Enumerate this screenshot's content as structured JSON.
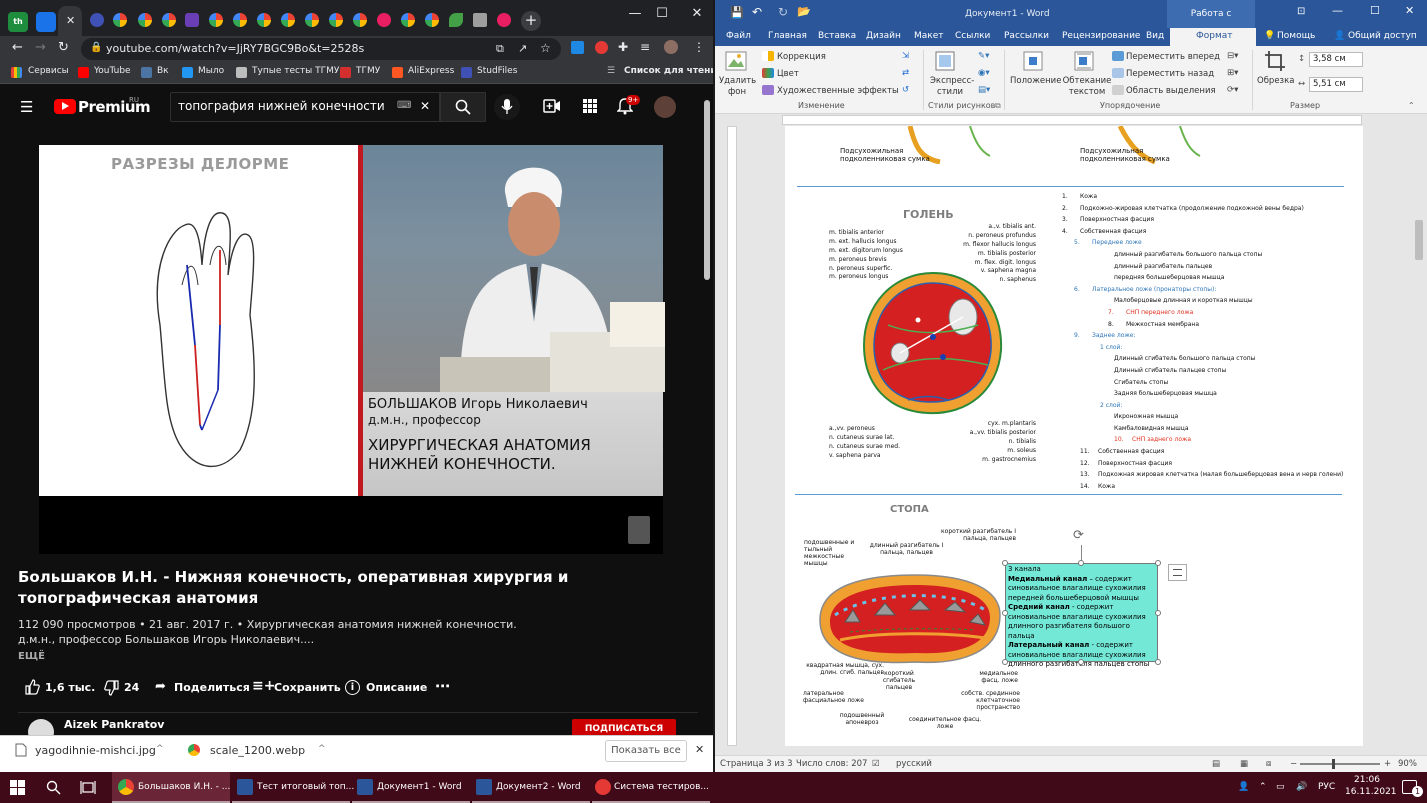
{
  "browser": {
    "tab_favicon_text": "th",
    "active_tab_close": "✕",
    "new_tab": "+",
    "url": "youtube.com/watch?v=JjRY7BGC9Bo&t=2528s",
    "window_controls": {
      "minimize": "—",
      "maximize": "☐",
      "close": "✕"
    },
    "bookmarks": [
      "Сервисы",
      "YouTube",
      "Вк",
      "Мыло",
      "Тупые тесты ТГМУ",
      "ТГМУ",
      "AliExpress",
      "StudFiles"
    ],
    "reading_list": "Список для чтения"
  },
  "youtube": {
    "brand": "Premium",
    "brand_region": "RU",
    "search_value": "топография нижней конечности",
    "search_clear": "✕",
    "notifications_badge": "9+",
    "video_title_slide": "РАЗРЕЗЫ ДЕЛОРМЕ",
    "caption_name": "БОЛЬШАКОВ Игорь Николаевич",
    "caption_degree": "д.м.н., профессор",
    "caption_course": "ХИРУРГИЧЕСКАЯ АНАТОМИЯ НИЖНЕЙ КОНЕЧНОСТИ.",
    "title": "Большаков И.Н. - Нижняя конечность, оперативная хирургия и топографическая анатомия",
    "meta_line1": "112 090 просмотров • 21 авг. 2017 г. • Хирургическая анатомия нижней конечности.",
    "meta_line2": "д.м.н., профессор Большаков Игорь Николаевич....",
    "more": "ЕЩЁ",
    "likes": "1,6 тыс.",
    "dislikes": "24",
    "share": "Поделиться",
    "save": "Сохранить",
    "description": "Описание",
    "more_actions": "⋯",
    "commenter": "Aizek Pankratov",
    "subscribe": "ПОДПИСАТЬСЯ"
  },
  "downloads": {
    "items": [
      "yagodihnie-mishci.jpg",
      "scale_1200.webp"
    ],
    "show_all": "Показать все",
    "close": "✕"
  },
  "word": {
    "doc_title": "Документ1 - Word",
    "context_tab": "Работа с рисунками",
    "tabs": [
      "Файл",
      "Главная",
      "Вставка",
      "Дизайн",
      "Макет",
      "Ссылки",
      "Рассылки",
      "Рецензирование",
      "Вид"
    ],
    "active_tab": "Формат",
    "help": "Помощь",
    "share": "Общий доступ",
    "ribbon": {
      "remove_bg": "Удалить фон",
      "correction": "Коррекция",
      "color": "Цвет",
      "artistic": "Художественные эффекты",
      "group_change": "Изменение",
      "express_styles": "Экспресс-стили",
      "group_styles": "Стили рисунков",
      "position": "Положение",
      "wrap_text": "Обтекание текстом",
      "bring_forward": "Переместить вперед",
      "send_backward": "Переместить назад",
      "selection_pane": "Область выделения",
      "group_arrange": "Упорядочение",
      "crop": "Обрезка",
      "height": "3,58 см",
      "width": "5,51 см",
      "group_size": "Размер"
    },
    "page": {
      "top_label_left": "Подсухожильная подколенниковая сумка",
      "top_label_right": "Подсухожильная подколенниковая сумка",
      "shin_title": "ГОЛЕНЬ",
      "foot_title": "СТОПА",
      "list": [
        {
          "n": "1.",
          "t": "Кожа",
          "c": ""
        },
        {
          "n": "2.",
          "t": "Подкожно-жировая клетчатка (продолжение подкожной вены бедра)",
          "c": ""
        },
        {
          "n": "3.",
          "t": "Поверхностная фасция",
          "c": ""
        },
        {
          "n": "4.",
          "t": "Собственная фасция",
          "c": ""
        },
        {
          "n": "5.",
          "t": "Переднее ложе",
          "c": "blue"
        },
        {
          "n": "",
          "t": "длинный разгибатель большого пальца стопы",
          "c": ""
        },
        {
          "n": "",
          "t": "длинный разгибатель пальцев",
          "c": ""
        },
        {
          "n": "",
          "t": "передняя большеберцовая мышца",
          "c": ""
        },
        {
          "n": "6.",
          "t": "Латеральное ложе (пронаторы стопы):",
          "c": "blue"
        },
        {
          "n": "",
          "t": "Малоберцовые длинная и короткая мышцы",
          "c": ""
        },
        {
          "n": "7.",
          "t": "СНП переднего ложа",
          "c": "red"
        },
        {
          "n": "8.",
          "t": "Межкостная мембрана",
          "c": ""
        },
        {
          "n": "9.",
          "t": "Заднее ложе:",
          "c": "blue"
        },
        {
          "n": "",
          "t": "1 слой:",
          "c": "blue"
        },
        {
          "n": "",
          "t": "Длинный сгибатель большого пальца стопы",
          "c": ""
        },
        {
          "n": "",
          "t": "Длинный сгибатель пальцев стопы",
          "c": ""
        },
        {
          "n": "",
          "t": "Сгибатель стопы",
          "c": ""
        },
        {
          "n": "",
          "t": "Задняя большеберцовая мышца",
          "c": ""
        },
        {
          "n": "",
          "t": "2 слой:",
          "c": "blue"
        },
        {
          "n": "",
          "t": "Икроножная мышца",
          "c": ""
        },
        {
          "n": "",
          "t": "Камбаловидная мышца",
          "c": ""
        },
        {
          "n": "10.",
          "t": "СНП заднего ложа",
          "c": "red"
        },
        {
          "n": "11.",
          "t": "Собственная фасция",
          "c": ""
        },
        {
          "n": "12.",
          "t": "Поверхностная фасция",
          "c": ""
        },
        {
          "n": "13.",
          "t": "Подкожная жировая клетчатка (малая большеберцовая вена и нерв голени)",
          "c": ""
        },
        {
          "n": "14.",
          "t": "Кожа",
          "c": ""
        }
      ],
      "shin_labels_left": [
        "m. tibialis anterior",
        "m. ext. hallucis longus",
        "m. ext. digitorum longus",
        "m. peroneus brevis",
        "n. peroneus superfic.",
        "m. peroneus longus"
      ],
      "shin_labels_right": [
        "a.,v. tibialis ant.",
        "n. peroneus profundus",
        "m. flexor hallucis longus",
        "m. tibialis posterior",
        "m. flex. digit. longus",
        "v. saphena magna",
        "n. saphenus"
      ],
      "shin_labels_bottom_left": [
        "a.,vv. peroneus",
        "n. cutaneus surae lat.",
        "n. cutaneus surae med.",
        "v. saphena parva"
      ],
      "shin_labels_bottom_right": [
        "сух. m.plantaris",
        "a.,vv. tibialis posterior",
        "n. tibialis",
        "m. soleus",
        "m. gastrocnemius"
      ],
      "foot_labels": {
        "a": "подошвенные и тыльный межкостные мышцы",
        "b": "длинный разгибатель I пальца, пальцев",
        "c": "короткий разгибатель I пальца, пальцев",
        "d": "квадратная мышца, сух. длин. сгиб. пальцев",
        "e": "короткий сгибатель пальцев",
        "f": "латеральное фасциальное ложе",
        "g": "подошвенный апоневроз",
        "h": "соединительное фасц. ложе",
        "i": "собств. срединное клетчаточное пространство",
        "j": "медиальное фасц. ложе"
      },
      "textbox": {
        "l1": "3 канала",
        "l2b": "Медиальный канал",
        "l2": " – содержит синовиальное влагалище сухожилия передней большеберцовой мышцы",
        "l3b": "Средний канал",
        "l3": " - содержит синовиальное влагалище сухожилия длинного разгибателя большого пальца",
        "l4b": "Латеральный канал",
        "l4": " - содержит синовиальное влагалище сухожилия длинного разгибателя пальцев стопы"
      }
    },
    "status": {
      "page": "Страница 3 из 3",
      "words": "Число слов: 207",
      "lang": "русский",
      "zoom": "90%"
    }
  },
  "taskbar": {
    "items": [
      "Большаков И.Н. - ...",
      "Тест итоговый топ...",
      "Документ1 - Word",
      "Документ2 - Word",
      "Система тестиров..."
    ],
    "lang": "РУС",
    "time": "21:06",
    "date": "16.11.2021",
    "notif": "1"
  }
}
